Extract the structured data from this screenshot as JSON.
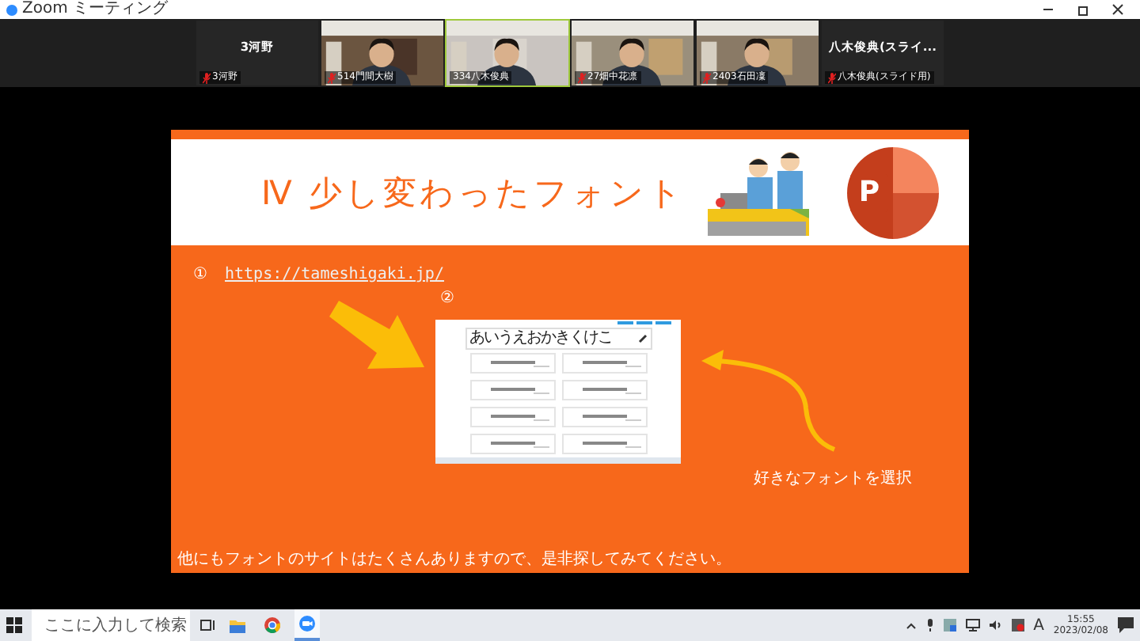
{
  "window": {
    "title": "Zoom ミーティング"
  },
  "participants": [
    {
      "name": "3河野",
      "display_name": "3河野",
      "video": false,
      "speaking": false,
      "muted": true
    },
    {
      "name": "514門間大樹",
      "video": true,
      "speaking": false,
      "muted": true
    },
    {
      "name": "334八木俊典",
      "video": true,
      "speaking": true,
      "muted": false
    },
    {
      "name": "27畑中花凛",
      "video": true,
      "speaking": false,
      "muted": true
    },
    {
      "name": "2403石田凜",
      "video": true,
      "speaking": false,
      "muted": true
    },
    {
      "name": "八木俊典(スライド用)",
      "display_name": "八木俊典(スライ...",
      "video": false,
      "speaking": false,
      "muted": true
    }
  ],
  "slide": {
    "title": "Ⅳ 少し変わったフォント",
    "logo_letter": "P",
    "step1_number": "①",
    "link": "https://tameshigaki.jp/",
    "step2_number": "②",
    "screenshot": {
      "search_text": "あいうえおかきくけこ"
    },
    "callout": "好きなフォントを選択",
    "footer": "他にもフォントのサイトはたくさんありますので、是非探してみてください。"
  },
  "taskbar": {
    "search_placeholder": "ここに入力して検索",
    "apps": [
      {
        "kind": "explorer",
        "selected": false
      },
      {
        "kind": "chrome",
        "selected": false
      },
      {
        "kind": "zoom",
        "selected": true
      }
    ],
    "ime": "A",
    "time": "15:55",
    "date": "2023/02/08"
  }
}
